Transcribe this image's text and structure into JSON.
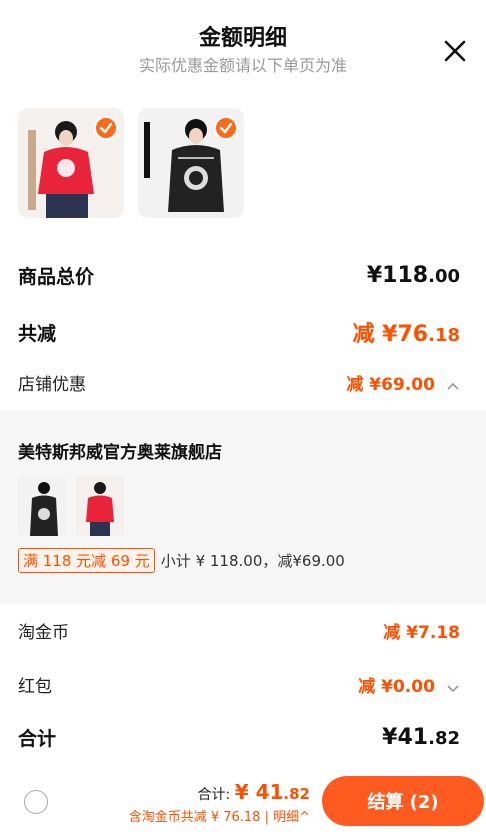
{
  "header": {
    "title": "金额明细",
    "subtitle": "实际优惠金额请以下单页为准"
  },
  "products": [
    {
      "name": "red-sweatshirt",
      "color": "#e8233a",
      "brand_text": "metersbonwe"
    },
    {
      "name": "black-sweatshirt",
      "color": "#222222",
      "brand_text": "metersbonwe"
    }
  ],
  "summary": {
    "total_label": "商品总价",
    "total_int": "¥118",
    "total_dec": ".00",
    "discount_label": "共减",
    "discount_int": "减 ¥76",
    "discount_dec": ".18",
    "store_discount_label": "店铺优惠",
    "store_discount_value": "减 ¥69.00"
  },
  "shop": {
    "name": "美特斯邦威官方奥莱旗舰店",
    "promo_tag": "满 118 元减 69 元",
    "promo_text": "小计 ¥ 118.00，减¥69.00"
  },
  "extras": {
    "coins_label": "淘金币",
    "coins_value": "减 ¥7.18",
    "redpacket_label": "红包",
    "redpacket_value": "减 ¥0.00",
    "sum_label": "合计",
    "sum_int": "¥41",
    "sum_dec": ".82"
  },
  "bottom": {
    "total_prefix": "合计: ",
    "total_int": "¥ 41",
    "total_dec": ".82",
    "sub_text": "含淘金币共减 ¥ 76.18 | 明细^",
    "checkout_label": "结算 (2)"
  },
  "colors": {
    "accent": "#ff5000",
    "button": "#ff5a1f"
  }
}
